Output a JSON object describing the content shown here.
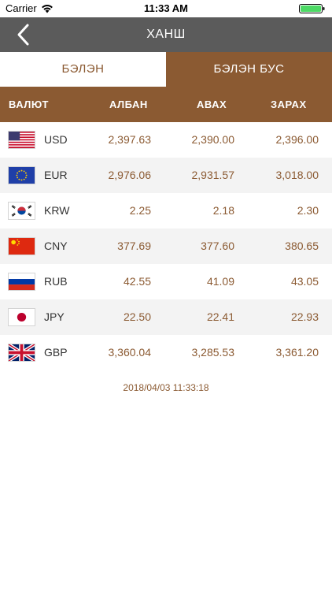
{
  "status_bar": {
    "carrier": "Carrier",
    "time": "11:33 AM"
  },
  "nav": {
    "title": "ХАНШ",
    "back_icon": "chevron-left-icon"
  },
  "tabs": [
    {
      "label": "БЭЛЭН",
      "active": false
    },
    {
      "label": "БЭЛЭН БУС",
      "active": true
    }
  ],
  "table": {
    "headers": {
      "currency": "ВАЛЮТ",
      "official": "АЛБАН",
      "buy": "АВАХ",
      "sell": "ЗАРАХ"
    },
    "rows": [
      {
        "code": "USD",
        "flag": "us-flag-icon",
        "official": "2,397.63",
        "buy": "2,390.00",
        "sell": "2,396.00"
      },
      {
        "code": "EUR",
        "flag": "eu-flag-icon",
        "official": "2,976.06",
        "buy": "2,931.57",
        "sell": "3,018.00"
      },
      {
        "code": "KRW",
        "flag": "kr-flag-icon",
        "official": "2.25",
        "buy": "2.18",
        "sell": "2.30"
      },
      {
        "code": "CNY",
        "flag": "cn-flag-icon",
        "official": "377.69",
        "buy": "377.60",
        "sell": "380.65"
      },
      {
        "code": "RUB",
        "flag": "ru-flag-icon",
        "official": "42.55",
        "buy": "41.09",
        "sell": "43.05"
      },
      {
        "code": "JPY",
        "flag": "jp-flag-icon",
        "official": "22.50",
        "buy": "22.41",
        "sell": "22.93"
      },
      {
        "code": "GBP",
        "flag": "gb-flag-icon",
        "official": "3,360.04",
        "buy": "3,285.53",
        "sell": "3,361.20"
      }
    ]
  },
  "timestamp": "2018/04/03 11:33:18",
  "colors": {
    "accent": "#8b5a32",
    "nav_bg": "#5b5b5b",
    "row_alt": "#f3f3f3"
  }
}
